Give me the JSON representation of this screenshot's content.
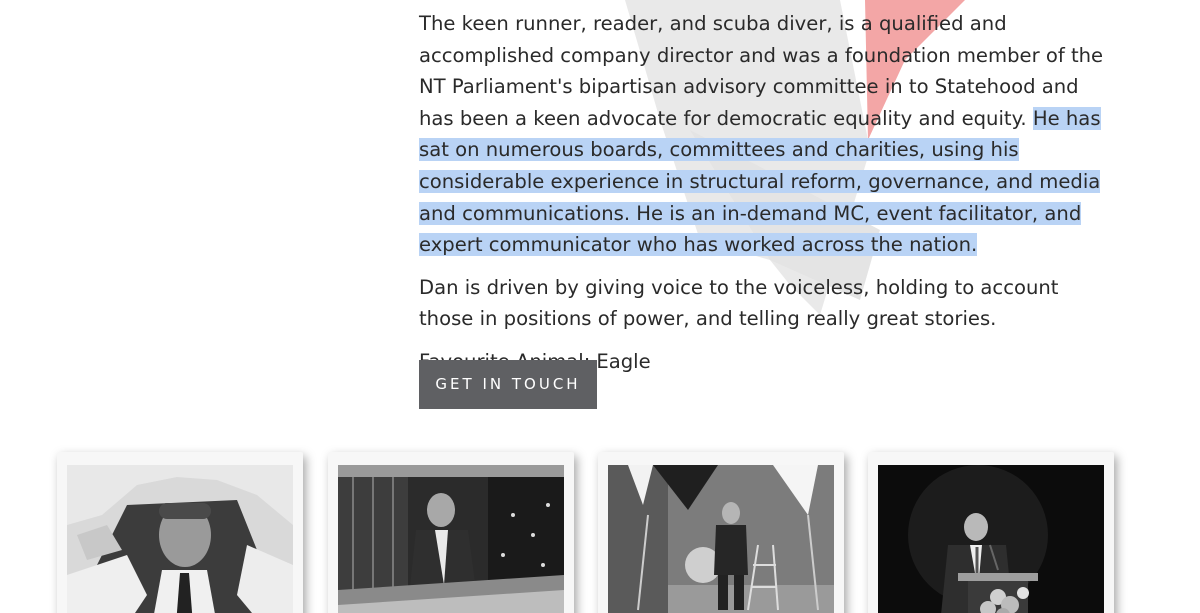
{
  "bio": {
    "para1_plain": "The keen runner, reader, and scuba diver, is a qualified and accomplished company director and was a foundation member of the NT Parliament's bipartisan advisory committee in to Statehood and has been a keen advocate for democratic equality and equity.",
    "para1_selected": "He has sat on numerous boards, committees and charities, using his considerable experience in structural reform, governance, and media and communications. He is an in-demand MC, event facilitator, and expert communicator who has worked across the nation.",
    "para2": "Dan is driven by giving voice to the voiceless, holding to account those in positions of power, and telling really great stories.",
    "favourite_label": "Favourite Animal:",
    "favourite_value": "Eagle"
  },
  "cta": {
    "label": "GET IN TOUCH"
  },
  "gallery": {
    "photos": [
      {
        "name": "photo-tearing-paper"
      },
      {
        "name": "photo-newsroom"
      },
      {
        "name": "photo-studio"
      },
      {
        "name": "photo-podium"
      }
    ]
  },
  "colors": {
    "selection": "#b9d3f5",
    "button_bg": "#5f6063",
    "accent_red": "#f2a9a9"
  }
}
